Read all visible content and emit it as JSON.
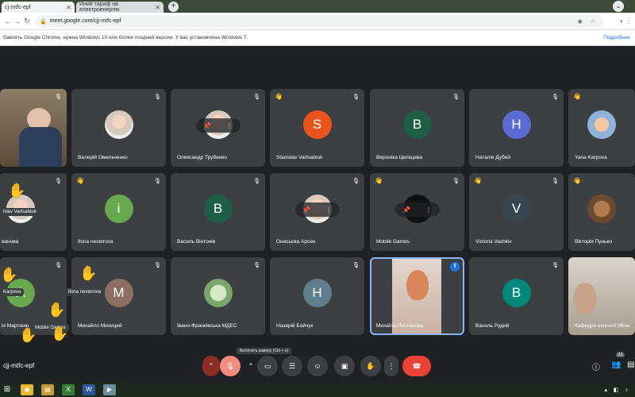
{
  "browser": {
    "tabs": [
      {
        "label": "cj-mtfc-epf",
        "active": true
      },
      {
        "label": "Иний тариф на електроенергію",
        "active": false
      }
    ],
    "url": "meet.google.com/cjj-mtfc-epf",
    "infobar_text": "бавлять Google Chrome, нужна Windows 10 или более поздней версии. У вас установлена Windows 7.",
    "infobar_more": "Подробнее"
  },
  "tiles": [
    {
      "name": "",
      "type": "video",
      "mic_off": true
    },
    {
      "name": "Валерій Омельченко",
      "type": "photo",
      "mic_off": true
    },
    {
      "name": "Олександр Трубенко",
      "type": "photo",
      "mic_off": true,
      "pin_bar": true
    },
    {
      "name": "Stanislav Vartsabiuk",
      "initial": "S",
      "color": "#e8541c",
      "mic_off": true,
      "hand": true
    },
    {
      "name": "Вероніка Целіщева",
      "initial": "B",
      "color": "#1e5e45",
      "mic_off": true
    },
    {
      "name": "Наталія Дубей",
      "initial": "H",
      "color": "#5b6bd1",
      "mic_off": true
    },
    {
      "name": "Yana Karpova",
      "type": "photo",
      "mic_off": false,
      "hand": true
    },
    {
      "name": "ванова",
      "type": "photo",
      "mic_off": true
    },
    {
      "name": "Ilona nesterova",
      "initial": "i",
      "color": "#6aa84f",
      "mic_off": true,
      "hand": true
    },
    {
      "name": "Василь Вінтонів",
      "initial": "B",
      "color": "#1e5e45",
      "mic_off": true
    },
    {
      "name": "Онисьєва Арсен",
      "type": "photo",
      "mic_off": true,
      "pin_bar": true
    },
    {
      "name": "Mobile Games",
      "type": "photo",
      "mic_off": true,
      "pin_bar": true,
      "hand": true
    },
    {
      "name": "Victoria Vashkiv",
      "initial": "V",
      "color": "#37474f",
      "mic_off": true,
      "hand": true
    },
    {
      "name": "Вікторія Пунько",
      "type": "photo",
      "mic_off": false,
      "hand": true
    },
    {
      "name": "ія Мартиню",
      "initial": "A",
      "color": "#6aa84f",
      "mic_off": true
    },
    {
      "name": "Михайло Михицей",
      "initial": "M",
      "color": "#8d6e63",
      "mic_off": true
    },
    {
      "name": "Івано-Франківська МДЕС",
      "type": "photo",
      "mic_off": true
    },
    {
      "name": "Назарій Бойчук",
      "initial": "H",
      "color": "#607d8b",
      "mic_off": true
    },
    {
      "name": "Михаїла Пистонова",
      "type": "video2",
      "mic_off": false,
      "speaking": true
    },
    {
      "name": "Василь Рудий",
      "initial": "B",
      "color": "#00897b",
      "mic_off": true
    },
    {
      "name": "Кафедра екології (Фізи",
      "type": "video3",
      "mic_off": false
    }
  ],
  "reactions": {
    "label1": "Karpova",
    "label2": "Ilona nesterova",
    "label3": "Mobile Games",
    "label4": "islav Vartsabiuk"
  },
  "bottombar": {
    "meeting_code": "cjj-mtfc-epf",
    "tooltip": "Включить камеру (Ctrl + e)",
    "participants_count": "21"
  }
}
